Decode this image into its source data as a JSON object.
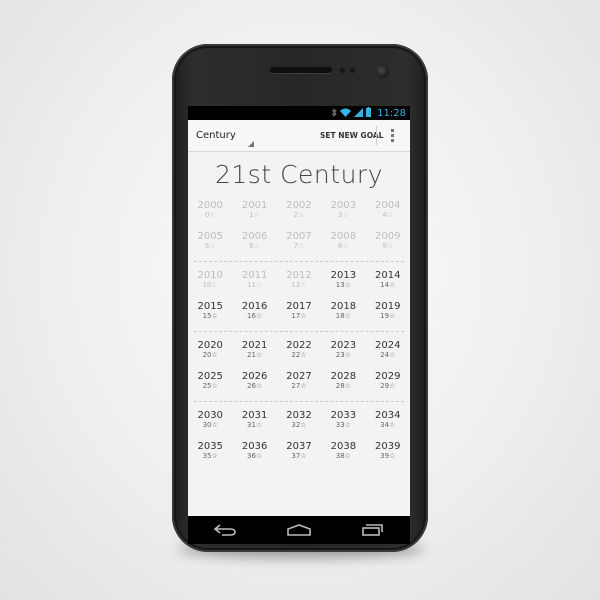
{
  "statusbar": {
    "time": "11:28"
  },
  "actionbar": {
    "spinner_label": "Century",
    "set_goal_label": "SET NEW GOAL"
  },
  "header": {
    "title": "21st Century"
  },
  "groups": [
    {
      "state": "faded",
      "rows": [
        [
          {
            "year": "2000",
            "count": "0☆"
          },
          {
            "year": "2001",
            "count": "1☆"
          },
          {
            "year": "2002",
            "count": "2☆"
          },
          {
            "year": "2003",
            "count": "3☆"
          },
          {
            "year": "2004",
            "count": "4☆"
          }
        ],
        [
          {
            "year": "2005",
            "count": "5☆"
          },
          {
            "year": "2006",
            "count": "6☆"
          },
          {
            "year": "2007",
            "count": "7☆"
          },
          {
            "year": "2008",
            "count": "8☆"
          },
          {
            "year": "2009",
            "count": "9☆"
          }
        ]
      ]
    },
    {
      "state": "mixed",
      "rows": [
        [
          {
            "year": "2010",
            "count": "10☆",
            "faded": true
          },
          {
            "year": "2011",
            "count": "11☆",
            "faded": true
          },
          {
            "year": "2012",
            "count": "12☆",
            "faded": true
          },
          {
            "year": "2013",
            "count": "13☆"
          },
          {
            "year": "2014",
            "count": "14☆"
          }
        ],
        [
          {
            "year": "2015",
            "count": "15☆"
          },
          {
            "year": "2016",
            "count": "16☆"
          },
          {
            "year": "2017",
            "count": "17☆"
          },
          {
            "year": "2018",
            "count": "18☆"
          },
          {
            "year": "2019",
            "count": "19☆"
          }
        ]
      ]
    },
    {
      "state": "active",
      "rows": [
        [
          {
            "year": "2020",
            "count": "20☆"
          },
          {
            "year": "2021",
            "count": "21☆"
          },
          {
            "year": "2022",
            "count": "22☆"
          },
          {
            "year": "2023",
            "count": "23☆"
          },
          {
            "year": "2024",
            "count": "24☆"
          }
        ],
        [
          {
            "year": "2025",
            "count": "25☆"
          },
          {
            "year": "2026",
            "count": "26☆"
          },
          {
            "year": "2027",
            "count": "27☆"
          },
          {
            "year": "2028",
            "count": "28☆"
          },
          {
            "year": "2029",
            "count": "29☆"
          }
        ]
      ]
    },
    {
      "state": "active",
      "rows": [
        [
          {
            "year": "2030",
            "count": "30☆"
          },
          {
            "year": "2031",
            "count": "31☆"
          },
          {
            "year": "2032",
            "count": "32☆"
          },
          {
            "year": "2033",
            "count": "33☆"
          },
          {
            "year": "2034",
            "count": "34☆"
          }
        ],
        [
          {
            "year": "2035",
            "count": "35☆"
          },
          {
            "year": "2036",
            "count": "36☆"
          },
          {
            "year": "2037",
            "count": "37☆"
          },
          {
            "year": "2038",
            "count": "38☆"
          },
          {
            "year": "2039",
            "count": "39☆"
          }
        ]
      ]
    }
  ],
  "icons": {
    "status": [
      "bluetooth-icon",
      "wifi-icon",
      "signal-icon",
      "battery-icon"
    ],
    "nav": [
      "back-icon",
      "home-icon",
      "recent-apps-icon"
    ],
    "overflow": "overflow-menu-icon"
  },
  "colors": {
    "status_accent": "#33b5e5",
    "faded_text": "#bdbdbd",
    "active_text": "#333333"
  }
}
